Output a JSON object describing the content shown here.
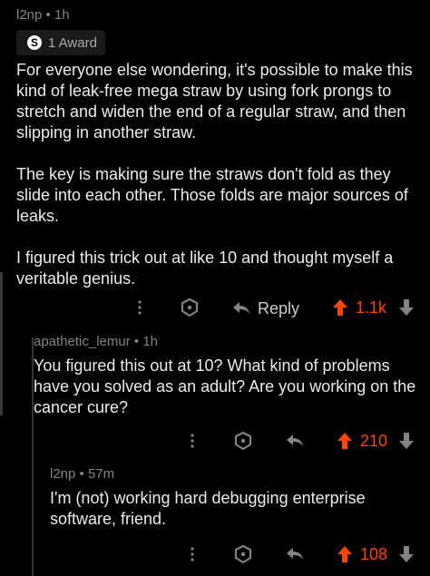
{
  "comment1": {
    "meta": "l2np • 1h",
    "award_label": "1 Award",
    "paragraphs": [
      "For everyone else wondering, it's possible to make this kind of leak-free mega straw by using fork prongs to stretch and widen the end of a regular straw, and then slipping in another straw.",
      "The key is making sure the straws don't fold as they slide into each other. Those folds are major sources of leaks.",
      "I figured this trick out at like 10 and thought myself a veritable genius."
    ],
    "reply_label": "Reply",
    "score": "1.1k"
  },
  "comment2": {
    "meta": "apathetic_lemur • 1h",
    "text": "You figured this out at 10? What kind of problems have you solved as an adult? Are you working on the cancer cure?",
    "score": "210"
  },
  "comment3": {
    "meta": "l2np • 57m",
    "text": "I'm (not) working hard debugging enterprise software, friend.",
    "score": "108"
  },
  "colors": {
    "background": "#000000",
    "upvote_accent": "#ff4500",
    "meta_gray": "#818384"
  }
}
